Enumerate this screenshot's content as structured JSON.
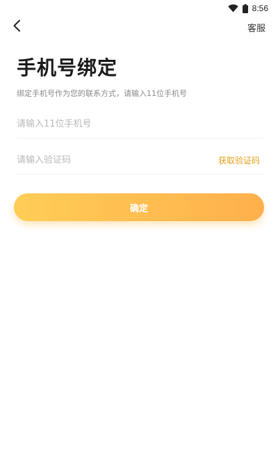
{
  "status_bar": {
    "time": "8:56",
    "icons": [
      "wifi-icon",
      "battery-icon"
    ]
  },
  "nav": {
    "back_icon": "chevron-left-icon",
    "service_label": "客服"
  },
  "header": {
    "title": "手机号绑定",
    "subtitle": "绑定手机号作为您的联系方式，请输入11位手机号"
  },
  "form": {
    "phone": {
      "value": "",
      "placeholder": "请输入11位手机号"
    },
    "code": {
      "value": "",
      "placeholder": "请输入验证码",
      "get_code_label": "获取验证码"
    },
    "confirm_label": "确定"
  },
  "colors": {
    "accent": "#e0a21a",
    "button_start": "#ffcd56",
    "button_end": "#ffb04c",
    "placeholder": "#b9b9b9"
  }
}
